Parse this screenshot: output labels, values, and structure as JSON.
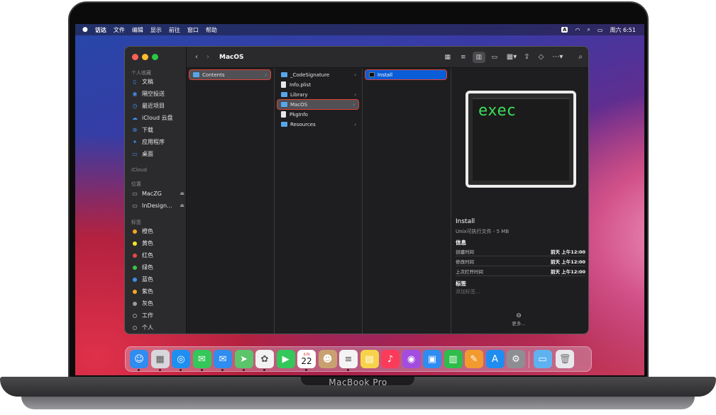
{
  "brand": "MacBook Pro",
  "menubar": {
    "apple": "",
    "items": [
      "访达",
      "文件",
      "编辑",
      "显示",
      "前往",
      "窗口",
      "帮助"
    ],
    "input_badge": "A",
    "clock": "周六 6:51"
  },
  "sidebar": {
    "favorites_header": "个人收藏",
    "favorites": [
      {
        "label": "文稿",
        "icon": "document-icon"
      },
      {
        "label": "隔空投送",
        "icon": "airdrop-icon"
      },
      {
        "label": "最近项目",
        "icon": "clock-icon"
      },
      {
        "label": "iCloud 云盘",
        "icon": "cloud-icon"
      },
      {
        "label": "下载",
        "icon": "download-icon"
      },
      {
        "label": "应用程序",
        "icon": "applications-icon"
      },
      {
        "label": "桌面",
        "icon": "desktop-icon"
      }
    ],
    "icloud_header": "iCloud",
    "locations_header": "位置",
    "locations": [
      {
        "label": "MacZG"
      },
      {
        "label": "InDesign..."
      }
    ],
    "tags_header": "标签",
    "tags": [
      {
        "label": "橙色",
        "color": "#f5a623"
      },
      {
        "label": "黄色",
        "color": "#f8e71c"
      },
      {
        "label": "红色",
        "color": "#e84848"
      },
      {
        "label": "绿色",
        "color": "#3cc24a"
      },
      {
        "label": "蓝色",
        "color": "#3f8ff0"
      },
      {
        "label": "紫色",
        "color": "#f5a623"
      },
      {
        "label": "灰色",
        "color": "#9a9a9e"
      },
      {
        "label": "工作",
        "color": "hollow"
      },
      {
        "label": "个人",
        "color": "hollow"
      }
    ]
  },
  "toolbar": {
    "title": "MacOS"
  },
  "columns": {
    "col1": [
      {
        "label": "Contents",
        "type": "folder",
        "has_children": true
      }
    ],
    "col2": [
      {
        "label": "_CodeSignature",
        "type": "folder",
        "has_children": true
      },
      {
        "label": "Info.plist",
        "type": "file",
        "has_children": false
      },
      {
        "label": "Library",
        "type": "folder",
        "has_children": true
      },
      {
        "label": "MacOS",
        "type": "folder",
        "has_children": true
      },
      {
        "label": "PkgInfo",
        "type": "file",
        "has_children": false
      },
      {
        "label": "Resources",
        "type": "folder",
        "has_children": true
      }
    ],
    "col3": [
      {
        "label": "Install",
        "type": "exec",
        "has_children": false
      }
    ]
  },
  "preview": {
    "icon_text": "exec",
    "name": "Install",
    "kind": "Unix可执行文件 - 5 MB",
    "info_header": "信息",
    "info": [
      {
        "k": "创建时间",
        "v": "前天 上午12:00"
      },
      {
        "k": "修改时间",
        "v": "前天 上午12:00"
      },
      {
        "k": "上次打开时间",
        "v": "前天 上午12:00"
      }
    ],
    "tags_header": "标签",
    "add_tag_placeholder": "添加标签...",
    "more_label": "更多..."
  },
  "dock": {
    "date_month": "JUN",
    "date_day": "22",
    "apps": [
      {
        "name": "finder-icon",
        "color": "#2f8cf0",
        "glyph": "☺"
      },
      {
        "name": "launchpad-icon",
        "color": "#d8d8dc",
        "glyph": "▦"
      },
      {
        "name": "safari-icon",
        "color": "#1e8ff0",
        "glyph": "◎"
      },
      {
        "name": "messages-icon",
        "color": "#34c759",
        "glyph": "✉"
      },
      {
        "name": "mail-icon",
        "color": "#2f8cf0",
        "glyph": "✉"
      },
      {
        "name": "maps-icon",
        "color": "#5cc46a",
        "glyph": "➤"
      },
      {
        "name": "photos-icon",
        "color": "#f2f2f2",
        "glyph": "✿"
      },
      {
        "name": "facetime-icon",
        "color": "#34c759",
        "glyph": "▶"
      },
      {
        "name": "calendar-icon",
        "color": "#ffffff",
        "glyph": ""
      },
      {
        "name": "contacts-icon",
        "color": "#c9a070",
        "glyph": "☻"
      },
      {
        "name": "reminders-icon",
        "color": "#f4f4f4",
        "glyph": "≡"
      },
      {
        "name": "notes-icon",
        "color": "#f7d24a",
        "glyph": "▤"
      },
      {
        "name": "music-icon",
        "color": "#fa3c5a",
        "glyph": "♪"
      },
      {
        "name": "podcasts-icon",
        "color": "#a34de0",
        "glyph": "◉"
      },
      {
        "name": "keynote-icon",
        "color": "#2f8cf0",
        "glyph": "▣"
      },
      {
        "name": "numbers-icon",
        "color": "#2ebd4a",
        "glyph": "▥"
      },
      {
        "name": "pages-icon",
        "color": "#f29a2e",
        "glyph": "✎"
      },
      {
        "name": "app-store-icon",
        "color": "#1f8df0",
        "glyph": "A"
      },
      {
        "name": "system-preferences-icon",
        "color": "#8e8e92",
        "glyph": "⚙"
      }
    ],
    "folder": {
      "name": "downloads-folder-icon",
      "color": "#5fb2f0"
    },
    "trash": {
      "name": "trash-icon",
      "color": "#e8e8ec"
    }
  }
}
